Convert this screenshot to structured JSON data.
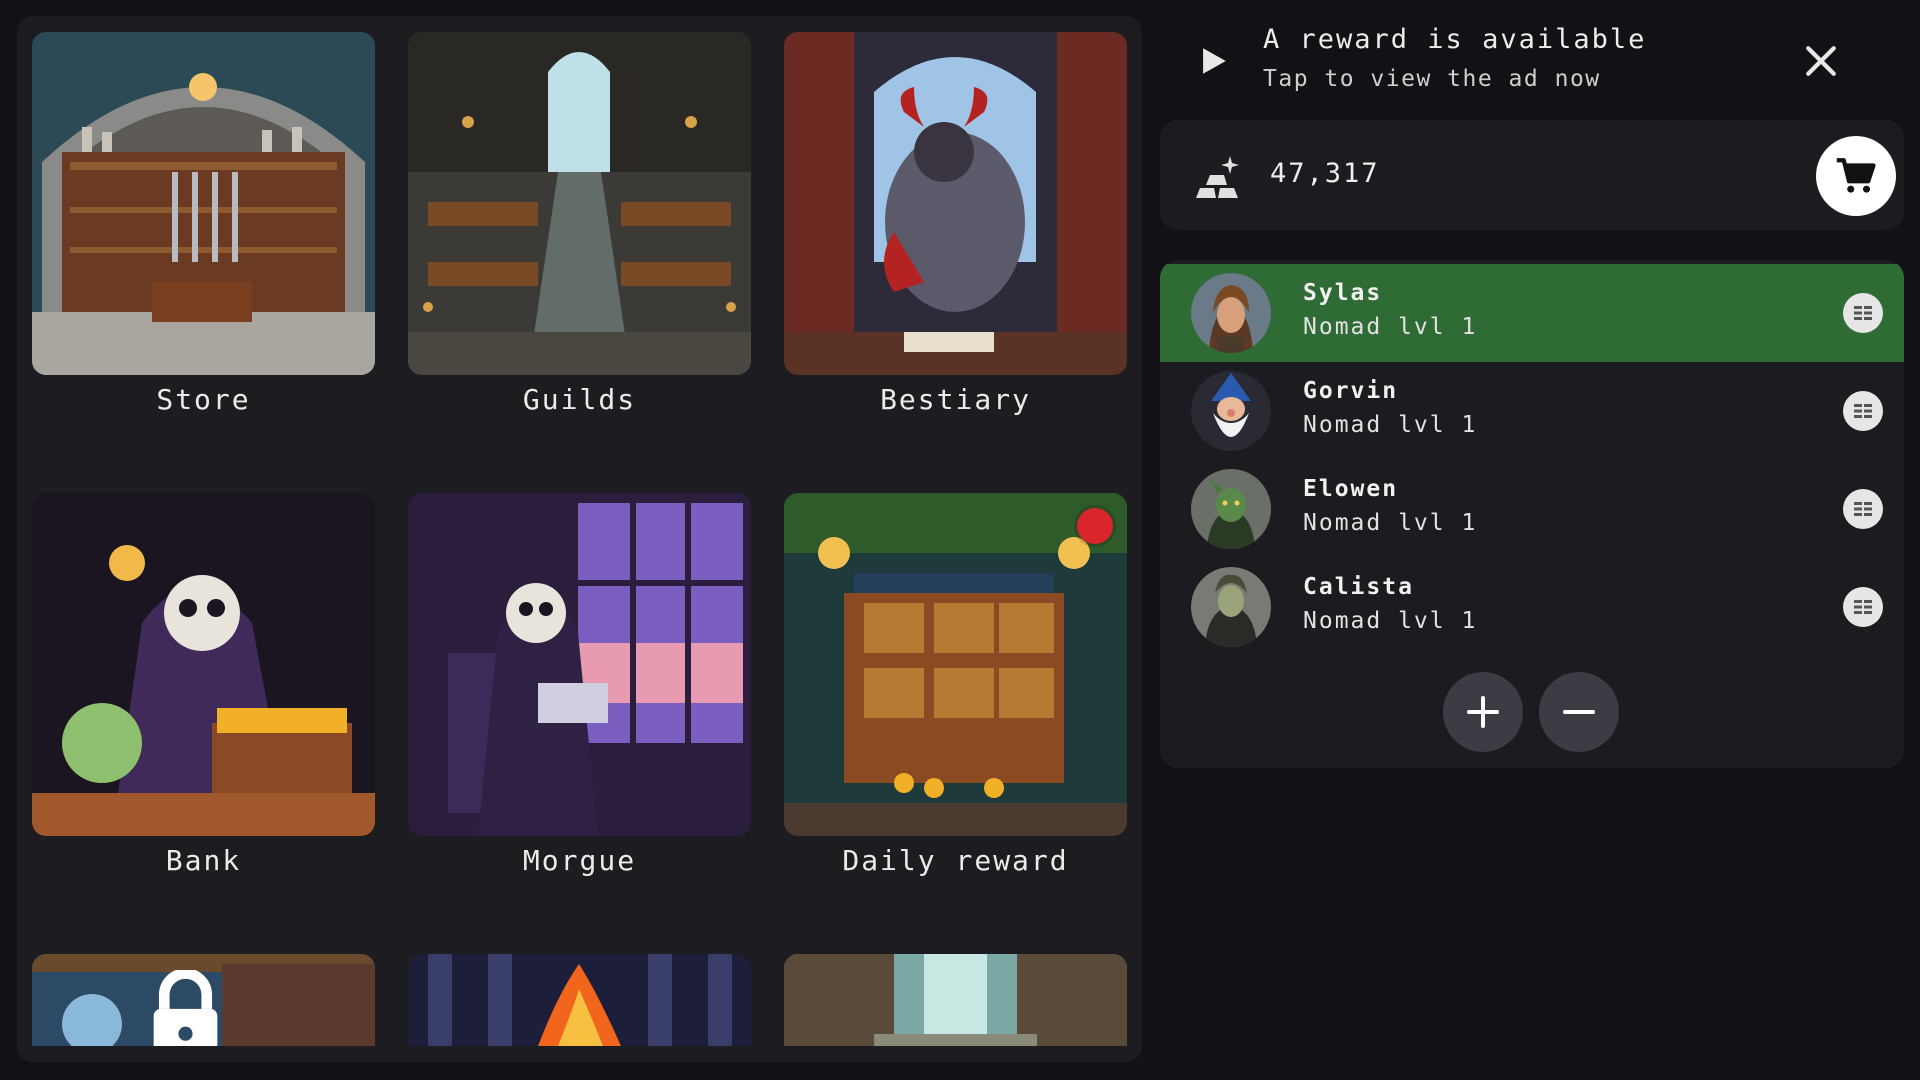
{
  "locations": [
    {
      "label": "Store"
    },
    {
      "label": "Guilds"
    },
    {
      "label": "Bestiary"
    },
    {
      "label": "Bank"
    },
    {
      "label": "Morgue"
    },
    {
      "label": "Daily reward"
    }
  ],
  "ad": {
    "title": "A reward is available",
    "subtitle": "Tap to view the ad now"
  },
  "currency": {
    "amount": "47,317",
    "icon": "gold-bars-icon"
  },
  "party": [
    {
      "name": "Sylas",
      "class": "Nomad lvl 1",
      "selected": true
    },
    {
      "name": "Gorvin",
      "class": "Nomad lvl 1",
      "selected": false
    },
    {
      "name": "Elowen",
      "class": "Nomad lvl 1",
      "selected": false
    },
    {
      "name": "Calista",
      "class": "Nomad lvl 1",
      "selected": false
    }
  ],
  "colors": {
    "background": "#121216",
    "panel": "#1d1c21",
    "selected_row": "#2e6b35",
    "notification": "#d9262c"
  }
}
